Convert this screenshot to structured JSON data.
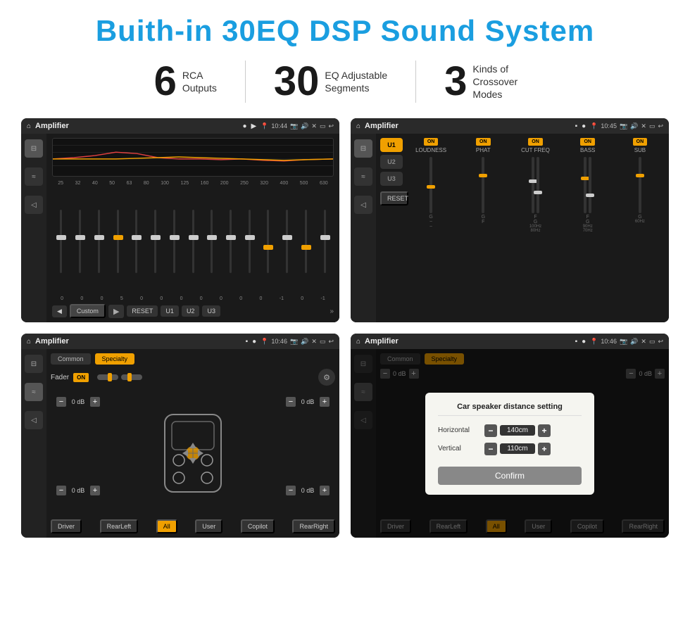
{
  "title": "Buith-in 30EQ DSP Sound System",
  "stats": [
    {
      "number": "6",
      "label": "RCA\nOutputs"
    },
    {
      "number": "30",
      "label": "EQ Adjustable\nSegments"
    },
    {
      "number": "3",
      "label": "Kinds of\nCrossover Modes"
    }
  ],
  "screens": {
    "eq": {
      "bar": {
        "title": "Amplifier",
        "time": "10:44"
      },
      "freqs": [
        "25",
        "32",
        "40",
        "50",
        "63",
        "80",
        "100",
        "125",
        "160",
        "200",
        "250",
        "320",
        "400",
        "500",
        "630"
      ],
      "values": [
        "0",
        "0",
        "0",
        "5",
        "0",
        "0",
        "0",
        "0",
        "0",
        "0",
        "0",
        "-1",
        "0",
        "-1"
      ],
      "buttons": [
        "◀",
        "Custom",
        "▶",
        "RESET",
        "U1",
        "U2",
        "U3"
      ]
    },
    "crossover": {
      "bar": {
        "title": "Amplifier",
        "time": "10:45"
      },
      "channels": [
        "U1",
        "U2",
        "U3"
      ],
      "params": [
        {
          "name": "LOUDNESS",
          "on": true
        },
        {
          "name": "PHAT",
          "on": true
        },
        {
          "name": "CUT FREQ",
          "on": true
        },
        {
          "name": "BASS",
          "on": true
        },
        {
          "name": "SUB",
          "on": true
        }
      ],
      "resetLabel": "RESET"
    },
    "fader": {
      "bar": {
        "title": "Amplifier",
        "time": "10:46"
      },
      "tabs": [
        "Common",
        "Specialty"
      ],
      "faderLabel": "Fader",
      "faderOn": "ON",
      "speakers": {
        "frontLeft": "0 dB",
        "frontRight": "0 dB",
        "rearLeft": "0 dB",
        "rearRight": "0 dB"
      },
      "bottomBtns": [
        "Driver",
        "RearLeft",
        "All",
        "User",
        "Copilot",
        "RearRight"
      ]
    },
    "faderDialog": {
      "bar": {
        "title": "Amplifier",
        "time": "10:46"
      },
      "tabs": [
        "Common",
        "Specialty"
      ],
      "dialog": {
        "title": "Car speaker distance setting",
        "horizontal": {
          "label": "Horizontal",
          "value": "140cm"
        },
        "vertical": {
          "label": "Vertical",
          "value": "110cm"
        },
        "confirmLabel": "Confirm"
      },
      "speakers": {
        "right": "0 dB",
        "rearRight": "0 dB"
      },
      "bottomBtns": [
        "Driver",
        "RearLeft",
        "All",
        "User",
        "Copilot",
        "RearRight"
      ]
    }
  }
}
